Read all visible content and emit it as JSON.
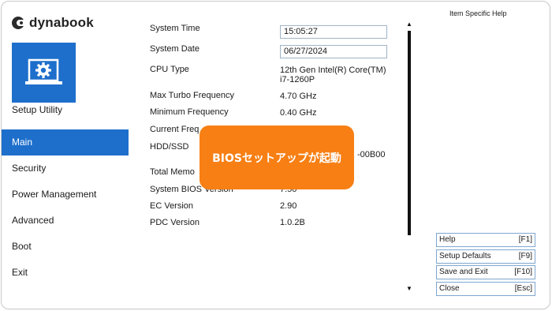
{
  "brand": {
    "logo_text": "dynabook"
  },
  "tile": {
    "label": "Setup Utility",
    "icon": "laptop-gear-icon",
    "color": "#1e6fcc"
  },
  "menu": {
    "items": [
      {
        "label": "Main",
        "active": true
      },
      {
        "label": "Security",
        "active": false
      },
      {
        "label": "Power Management",
        "active": false
      },
      {
        "label": "Advanced",
        "active": false
      },
      {
        "label": "Boot",
        "active": false
      },
      {
        "label": "Exit",
        "active": false
      }
    ]
  },
  "info": {
    "system_time": {
      "label": "System Time",
      "value": "15:05:27"
    },
    "system_date": {
      "label": "System Date",
      "value": "06/27/2024"
    },
    "cpu_type": {
      "label": "CPU Type",
      "value_line1": "12th Gen Intel(R) Core(TM)",
      "value_line2": "i7-1260P"
    },
    "max_turbo": {
      "label": "Max Turbo Frequency",
      "value": "4.70 GHz"
    },
    "min_freq": {
      "label": "Minimum Frequency",
      "value": "0.40 GHz"
    },
    "current_freq": {
      "label": "Current Freq"
    },
    "hdd_ssd": {
      "label": "HDD/SSD",
      "value": "-00B00"
    },
    "total_memory": {
      "label": "Total Memo"
    },
    "system_bios": {
      "label": "System BIOS Version",
      "value": "7.50"
    },
    "ec_version": {
      "label": "EC Version",
      "value": "2.90"
    },
    "pdc_version": {
      "label": "PDC Version",
      "value": "1.0.2B"
    }
  },
  "help": {
    "title": "Item Specific Help"
  },
  "scroll": {
    "up": "▲",
    "down": "▼"
  },
  "keys": [
    {
      "label": "Help",
      "key": "[F1]"
    },
    {
      "label": "Setup Defaults",
      "key": "[F9]"
    },
    {
      "label": "Save and Exit",
      "key": "[F10]"
    },
    {
      "label": "Close",
      "key": "[Esc]"
    }
  ],
  "overlay": {
    "text": "BIOSセットアップが起動",
    "color": "#f77f14"
  }
}
